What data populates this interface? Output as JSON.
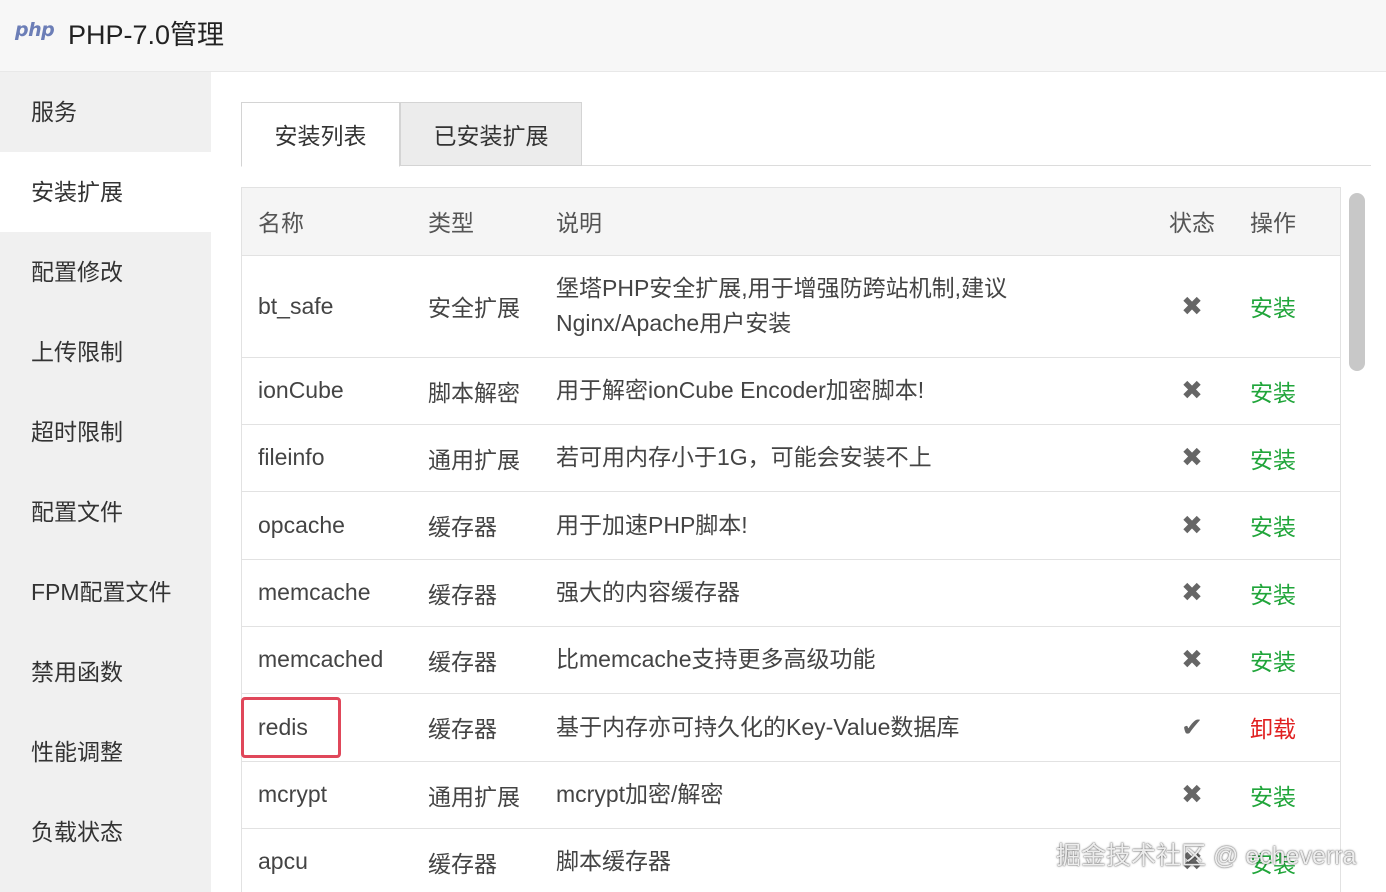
{
  "window": {
    "logo": "php",
    "title": "PHP-7.0管理"
  },
  "sidebar": {
    "items": [
      {
        "label": "服务",
        "active": false
      },
      {
        "label": "安装扩展",
        "active": true
      },
      {
        "label": "配置修改",
        "active": false
      },
      {
        "label": "上传限制",
        "active": false
      },
      {
        "label": "超时限制",
        "active": false
      },
      {
        "label": "配置文件",
        "active": false
      },
      {
        "label": "FPM配置文件",
        "active": false
      },
      {
        "label": "禁用函数",
        "active": false
      },
      {
        "label": "性能调整",
        "active": false
      },
      {
        "label": "负载状态",
        "active": false
      }
    ]
  },
  "tabs": [
    {
      "label": "安装列表",
      "active": true
    },
    {
      "label": "已安装扩展",
      "active": false
    }
  ],
  "table": {
    "headers": {
      "name": "名称",
      "type": "类型",
      "desc": "说明",
      "status": "状态",
      "op": "操作"
    },
    "rows": [
      {
        "name": "bt_safe",
        "type": "安全扩展",
        "desc": "堡塔PHP安全扩展,用于增强防跨站机制,建议Nginx/Apache用户安装",
        "status": "✖",
        "op": "安装"
      },
      {
        "name": "ionCube",
        "type": "脚本解密",
        "desc": "用于解密ionCube Encoder加密脚本!",
        "status": "✖",
        "op": "安装"
      },
      {
        "name": "fileinfo",
        "type": "通用扩展",
        "desc": "若可用内存小于1G，可能会安装不上",
        "status": "✖",
        "op": "安装"
      },
      {
        "name": "opcache",
        "type": "缓存器",
        "desc": "用于加速PHP脚本!",
        "status": "✖",
        "op": "安装"
      },
      {
        "name": "memcache",
        "type": "缓存器",
        "desc": "强大的内容缓存器",
        "status": "✖",
        "op": "安装"
      },
      {
        "name": "memcached",
        "type": "缓存器",
        "desc": "比memcache支持更多高级功能",
        "status": "✖",
        "op": "安装"
      },
      {
        "name": "redis",
        "type": "缓存器",
        "desc": "基于内存亦可持久化的Key-Value数据库",
        "status": "✔",
        "op": "卸载"
      },
      {
        "name": "mcrypt",
        "type": "通用扩展",
        "desc": "mcrypt加密/解密",
        "status": "✖",
        "op": "安装"
      },
      {
        "name": "apcu",
        "type": "缓存器",
        "desc": "脚本缓存器",
        "status": "✖",
        "op": "安装"
      }
    ]
  },
  "colors": {
    "install": "#20a53a",
    "uninstall": "#e02020",
    "highlight": "#e0475a"
  },
  "watermark": "掘金技术社区 @ echeverra"
}
